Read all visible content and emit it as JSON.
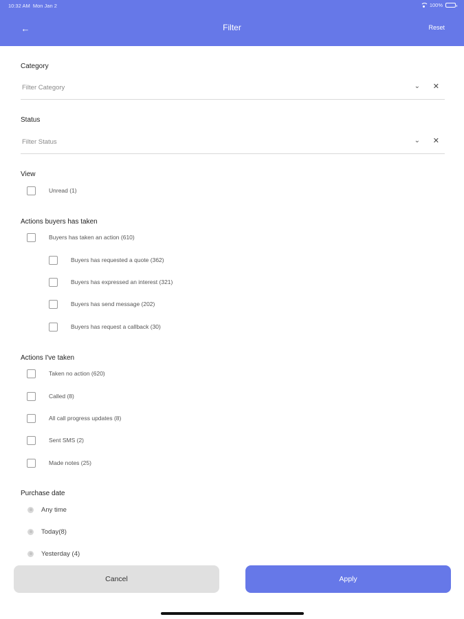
{
  "status_bar": {
    "time": "10:32 AM",
    "date": "Mon Jan 2",
    "battery": "100%"
  },
  "header": {
    "title": "Filter",
    "reset_label": "Reset",
    "back_icon": "arrow-left-icon"
  },
  "category": {
    "label": "Category",
    "placeholder": "Filter Category"
  },
  "status": {
    "label": "Status",
    "placeholder": "Filter Status"
  },
  "view": {
    "label": "View",
    "options": [
      "Unread (1)"
    ]
  },
  "buyer_actions": {
    "label": "Actions buyers has taken",
    "parent": "Buyers has taken an action (610)",
    "children": [
      "Buyers has requested a quote (362)",
      "Buyers has expressed an interest (321)",
      "Buyers has send message (202)",
      "Buyers has request a callback (30)"
    ]
  },
  "my_actions": {
    "label": "Actions I've taken",
    "options": [
      "Taken no action (620)",
      "Called (8)",
      "All call progress updates (8)",
      "Sent SMS (2)",
      "Made notes (25)"
    ]
  },
  "purchase_date": {
    "label": "Purchase date",
    "options": [
      "Any time",
      "Today(8)",
      "Yesterday (4)"
    ]
  },
  "footer": {
    "cancel_label": "Cancel",
    "apply_label": "Apply"
  },
  "colors": {
    "accent": "#6678e8",
    "cancel_bg": "#e0e0e0"
  }
}
